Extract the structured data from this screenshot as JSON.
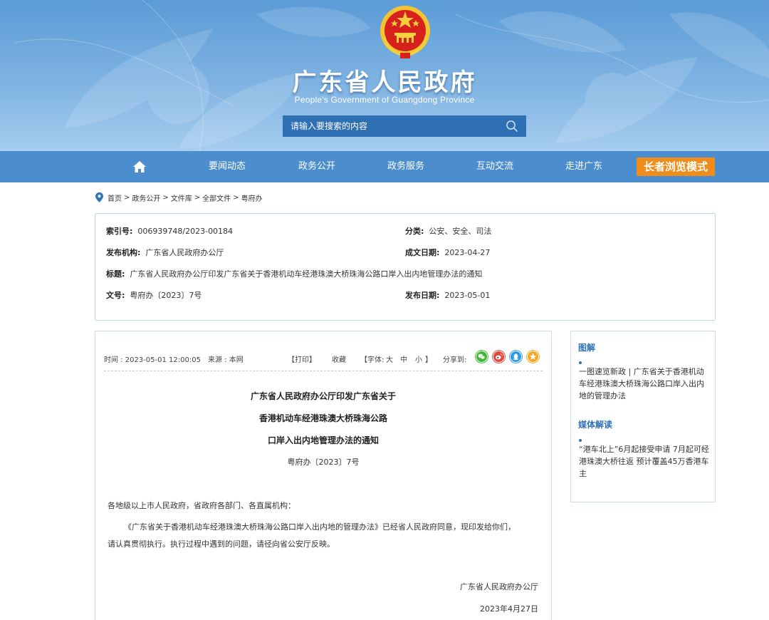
{
  "site": {
    "title": "广东省人民政府",
    "subtitle": "People's Government of Guangdong Province"
  },
  "search": {
    "placeholder": "请输入要搜索的内容"
  },
  "nav": {
    "items": [
      {
        "label": "要闻动态"
      },
      {
        "label": "政务公开"
      },
      {
        "label": "政务服务"
      },
      {
        "label": "互动交流"
      },
      {
        "label": "走进广东"
      }
    ],
    "elder_mode": "长者浏览模式"
  },
  "breadcrumb": [
    {
      "label": "首页"
    },
    {
      "label": "政务公开"
    },
    {
      "label": "文件库"
    },
    {
      "label": "全部文件"
    },
    {
      "label": "粤府办"
    }
  ],
  "breadcrumb_sep": ">",
  "meta": {
    "index_label": "索引号:",
    "index_value": "006939748/2023-00184",
    "category_label": "分类:",
    "category_value": "公安、安全、司法",
    "publisher_label": "发布机构:",
    "publisher_value": "广东省人民政府办公厅",
    "created_label": "成文日期:",
    "created_value": "2023-04-27",
    "title_label": "标题:",
    "title_value": "广东省人民政府办公厅印发广东省关于香港机动车经港珠澳大桥珠海公路口岸入出内地管理办法的通知",
    "docno_label": "文号:",
    "docno_value": "粤府办〔2023〕7号",
    "published_label": "发布日期:",
    "published_value": "2023-05-01"
  },
  "toolbar": {
    "time": "时间 : 2023-05-01 12:00:05",
    "source": "来源 : 本网",
    "print": "【打印】",
    "favorite": "收藏",
    "font_open": "【字体:",
    "font_large": "大",
    "font_medium": "中",
    "font_small": "小",
    "font_close": "】",
    "share": "分享到:"
  },
  "share_icons": [
    {
      "name": "wechat-icon",
      "color": "#3fb936"
    },
    {
      "name": "weibo-icon",
      "color": "#e6453c"
    },
    {
      "name": "qq-icon",
      "color": "#2d9be6"
    },
    {
      "name": "qzone-icon",
      "color": "#f5a623"
    }
  ],
  "doc": {
    "title_line1": "广东省人民政府办公厅印发广东省关于",
    "title_line2": "香港机动车经港珠澳大桥珠海公路",
    "title_line3": "口岸入出内地管理办法的通知",
    "doc_number": "粤府办〔2023〕7号",
    "salutation": "各地级以上市人民政府，省政府各部门、各直属机构：",
    "para1_line1": "《广东省关于香港机动车经港珠澳大桥珠海公路口岸入出内地的管理办法》已经省人民政府同意，现印发给你们，",
    "para1_line2": "请认真贯彻执行。执行过程中遇到的问题，请径向省公安厅反映。",
    "signature": "广东省人民政府办公厅",
    "date": "2023年4月27日"
  },
  "sidebar": {
    "section1_title": "图解",
    "section1_link": "一图速览新政 | 广东省关于香港机动车经港珠澳大桥珠海公路口岸入出内地的管理办法",
    "section2_title": "媒体解读",
    "section2_link": "“港车北上”6月起接受申请 7月起可经港珠澳大桥往返 预计覆盖45万香港车主"
  },
  "colors": {
    "header_blue": "#5b9bd6",
    "nav_blue": "#4b8dcd",
    "search_bg": "#2f6fb3",
    "elder_orange": "#f08c1a",
    "accent_blue": "#2f73b8"
  }
}
